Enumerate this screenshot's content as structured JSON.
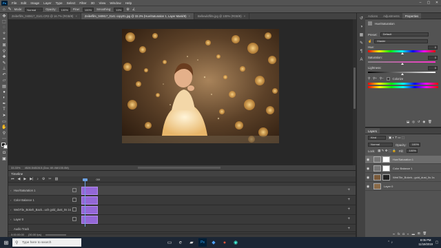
{
  "menu": {
    "logo": "Ps",
    "items": [
      "File",
      "Edit",
      "Image",
      "Layer",
      "Type",
      "Select",
      "Filter",
      "3D",
      "View",
      "Window",
      "Help"
    ]
  },
  "options_bar": {
    "mode_label": "Mode:",
    "mode_value": "Normal",
    "opacity_label": "Opacity:",
    "opacity_value": "100%",
    "flow_label": "Flow:",
    "flow_value": "100%",
    "smoothing_label": "Smoothing:",
    "smoothing_value": "10%"
  },
  "tabs": [
    {
      "label": "Zeilerfilm_040817_0141.CR3 @ 16.7% (RGB/8)",
      "active": false
    },
    {
      "label": "Zeilerfilm_040817_0141 copy01.jpg @ 33.3% (Hue/Saturation 1, Layer Mask/8)",
      "active": true
    },
    {
      "label": "Bellewildfilm.jpg @ 100% (RGB/8)",
      "active": false
    }
  ],
  "status": {
    "zoom": "33.33%",
    "doc": "4528.5/4528.5 (Doc: 69.4M/135.0M)"
  },
  "timeline": {
    "title": "Timeline",
    "tracks": [
      {
        "name": "Hue/Saturation 1"
      },
      {
        "name": "Color Balance 1"
      },
      {
        "name": "WebTile_Bokeh_Back...uch gold_dust_0s 1s"
      },
      {
        "name": "Layer 0"
      }
    ],
    "audio_label": "Audio Track",
    "timecode": "0:00:00:00",
    "fps": "(30.00 fps)",
    "ruler_mark": "05f"
  },
  "properties": {
    "tabs": [
      "Actions",
      "Adjustments",
      "Properties"
    ],
    "active_tab": "Properties",
    "panel_title": "Hue/Saturation",
    "preset_label": "Preset:",
    "preset_value": "Default",
    "channel_value": "Master",
    "hue_label": "Hue:",
    "hue_value": "0",
    "saturation_label": "Saturation:",
    "saturation_value": "0",
    "lightness_label": "Lightness:",
    "lightness_value": "0",
    "colorize_label": "Colorize"
  },
  "layers": {
    "tabs": [
      "Layers"
    ],
    "filter": "Kind",
    "blend_mode": "Normal",
    "opacity_label": "Opacity:",
    "opacity_value": "100%",
    "lock_label": "Lock:",
    "fill_label": "Fill:",
    "fill_value": "100%",
    "items": [
      {
        "name": "Hue/Saturation 1",
        "active": true
      },
      {
        "name": "Color Balance 1",
        "active": false
      },
      {
        "name": "WebTile_Bokeh...gold_dust_0s 1s",
        "active": false
      },
      {
        "name": "Layer 0",
        "active": false
      }
    ]
  },
  "taskbar": {
    "search_placeholder": "Type here to search",
    "time": "8:05 PM",
    "date": "11/19/2019"
  },
  "colors": {
    "accent": "#31a8ff",
    "clip": "#9467d6",
    "panel": "#535353"
  }
}
